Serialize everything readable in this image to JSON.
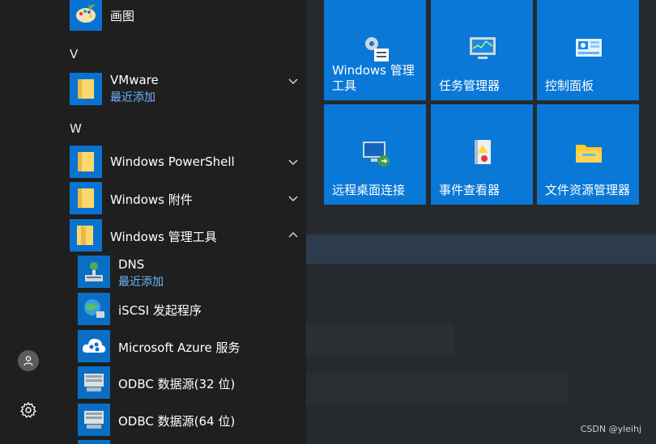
{
  "apps": {
    "paint": "画图",
    "letter_v": "V",
    "vmware": {
      "label": "VMware",
      "sub": "最近添加"
    },
    "letter_w": "W",
    "powershell": "Windows PowerShell",
    "accessories": "Windows 附件",
    "admin_tools": "Windows 管理工具",
    "dns": {
      "label": "DNS",
      "sub": "最近添加"
    },
    "iscsi": "iSCSI 发起程序",
    "azure": "Microsoft Azure 服务",
    "odbc32": "ODBC 数据源(32 位)",
    "odbc64": "ODBC 数据源(64 位)"
  },
  "tiles": [
    {
      "label": "Windows 管理工具"
    },
    {
      "label": "任务管理器"
    },
    {
      "label": "控制面板"
    },
    {
      "label": "远程桌面连接"
    },
    {
      "label": "事件查看器"
    },
    {
      "label": "文件资源管理器"
    }
  ],
  "watermark": "CSDN @yleihj",
  "colors": {
    "tile": "#0a78d7",
    "accent_text": "#6fb6ff",
    "menu_bg": "#1f1f1f"
  }
}
